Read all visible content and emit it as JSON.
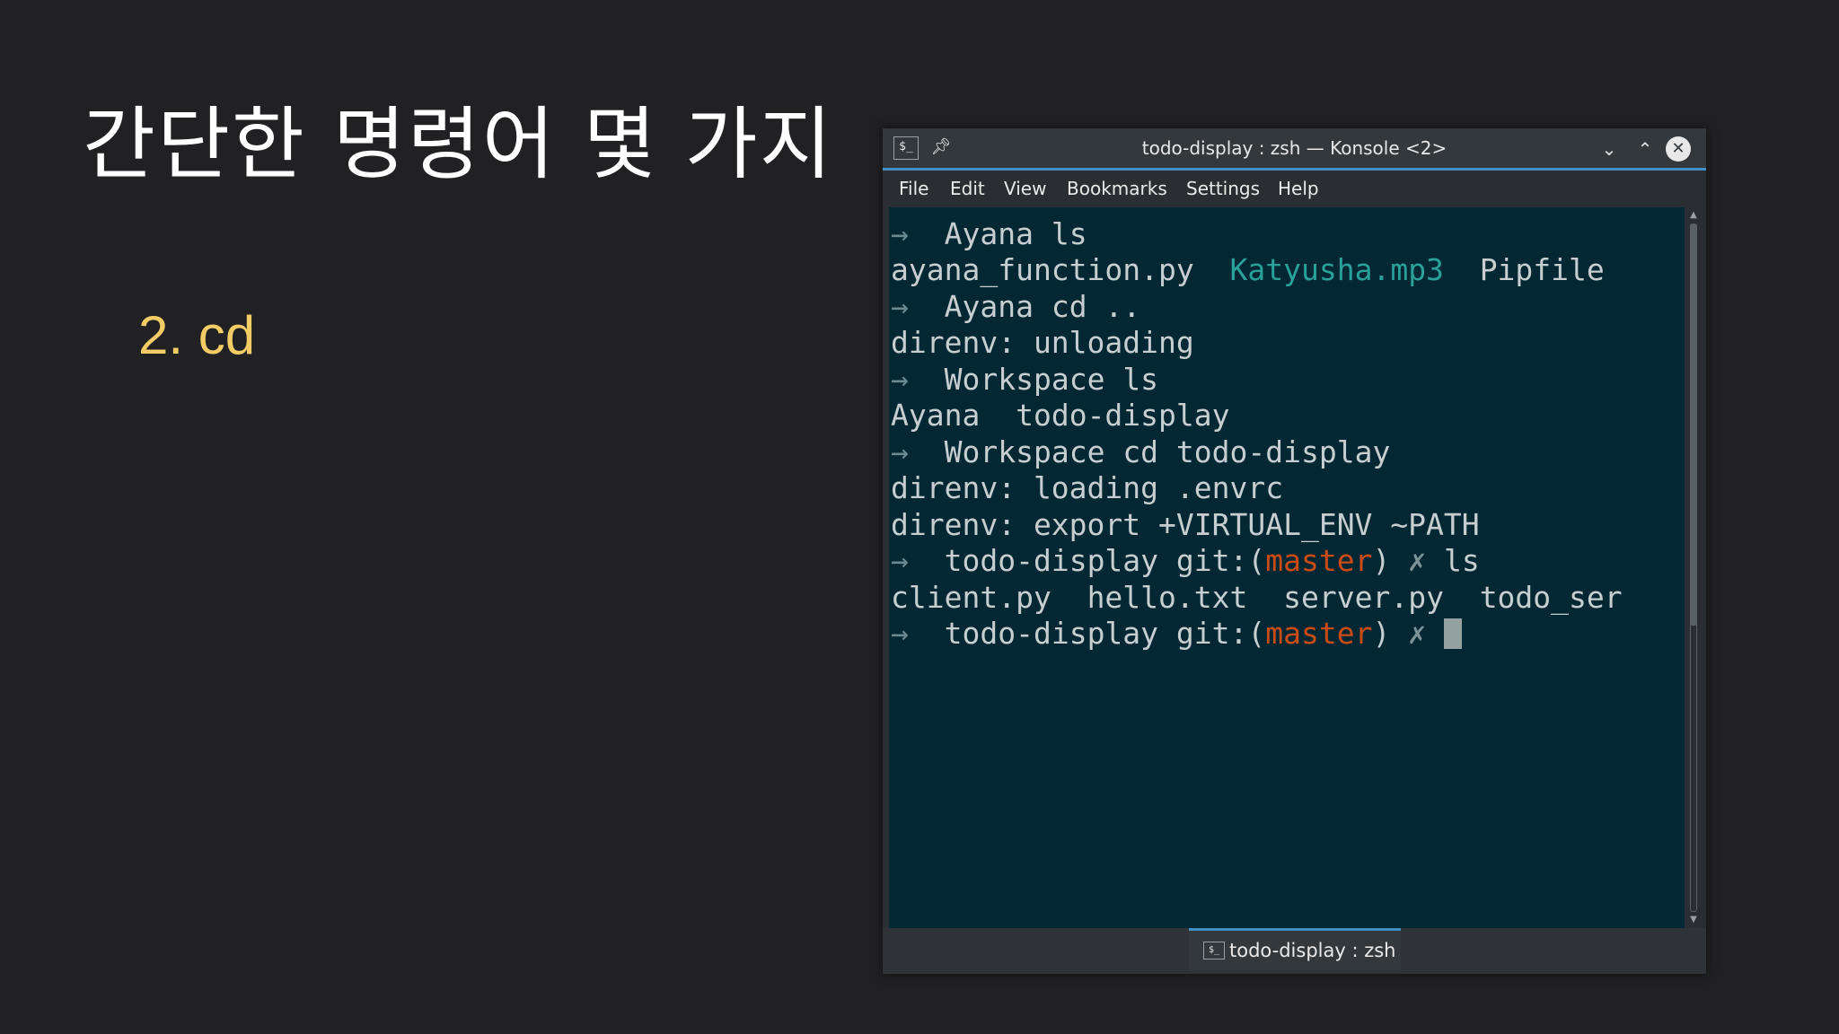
{
  "slide": {
    "title": "간단한 명령어 몇 가지",
    "bullet": "2. cd"
  },
  "window": {
    "title": "todo-display : zsh — Konsole <2>",
    "icons": {
      "terminal": "terminal-icon",
      "pin": "pin-icon",
      "minimize": "chevron-down-icon",
      "maximize": "chevron-up-icon",
      "close": "close-icon"
    }
  },
  "menu": [
    "File",
    "Edit",
    "View",
    "Bookmarks",
    "Settings",
    "Help"
  ],
  "terminal": {
    "arrow": "→",
    "lines": {
      "l1": {
        "dir": "Ayana",
        "cmd": "ls"
      },
      "l2": {
        "a": "ayana_function.py",
        "b": "Katyusha.mp3",
        "c": "Pipfile"
      },
      "l3": {
        "dir": "Ayana",
        "cmd": "cd .."
      },
      "l4": "direnv: unloading",
      "l5": {
        "dir": "Workspace",
        "cmd": "ls"
      },
      "l6": {
        "a": "Ayana",
        "b": "todo-display"
      },
      "l7": {
        "dir": "Workspace",
        "cmd": "cd todo-display"
      },
      "l8": "direnv: loading .envrc",
      "l9": "direnv: export +VIRTUAL_ENV ~PATH",
      "l10": {
        "dir": "todo-display",
        "git": "git:(",
        "branch": "master",
        "close": ")",
        "mark": "✗",
        "cmd": "ls"
      },
      "l11": {
        "a": "client.py",
        "b": "hello.txt",
        "c": "server.py",
        "d": "todo_ser"
      },
      "l12": {
        "dir": "todo-display",
        "git": "git:(",
        "branch": "master",
        "close": ")",
        "mark": "✗"
      }
    },
    "colors": {
      "background": "#032833",
      "text": "#c7ced1",
      "teal": "#2aa198",
      "branch": "#cb4b16"
    }
  },
  "tab": {
    "label": "todo-display : zsh"
  }
}
